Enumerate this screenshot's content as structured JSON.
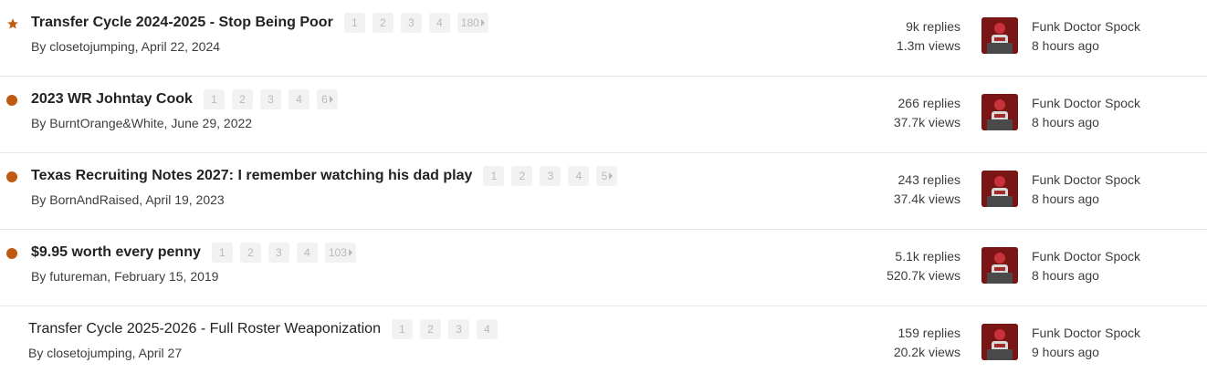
{
  "topics": [
    {
      "marker": "star",
      "title": "Transfer Cycle 2024-2025 - Stop Being Poor",
      "bold": true,
      "pages": [
        "1",
        "2",
        "3",
        "4",
        "180"
      ],
      "author": "closetojumping",
      "date": "April 22, 2024",
      "replies": "9k replies",
      "views": "1.3m views",
      "last_poster": "Funk Doctor Spock",
      "last_time": "8 hours ago"
    },
    {
      "marker": "dot",
      "title": "2023 WR Johntay Cook",
      "bold": true,
      "pages": [
        "1",
        "2",
        "3",
        "4",
        "6"
      ],
      "author": "BurntOrange&White",
      "date": "June 29, 2022",
      "replies": "266 replies",
      "views": "37.7k views",
      "last_poster": "Funk Doctor Spock",
      "last_time": "8 hours ago"
    },
    {
      "marker": "dot",
      "title": "Texas Recruiting Notes 2027: I remember watching his dad play",
      "bold": true,
      "pages": [
        "1",
        "2",
        "3",
        "4",
        "5"
      ],
      "author": "BornAndRaised",
      "date": "April 19, 2023",
      "replies": "243 replies",
      "views": "37.4k views",
      "last_poster": "Funk Doctor Spock",
      "last_time": "8 hours ago"
    },
    {
      "marker": "dot",
      "title": "$9.95 worth every penny",
      "bold": true,
      "pages": [
        "1",
        "2",
        "3",
        "4",
        "103"
      ],
      "author": "futureman",
      "date": "February 15, 2019",
      "replies": "5.1k replies",
      "views": "520.7k views",
      "last_poster": "Funk Doctor Spock",
      "last_time": "8 hours ago"
    },
    {
      "marker": "none",
      "title": "Transfer Cycle 2025-2026 - Full Roster Weaponization",
      "bold": false,
      "pages": [
        "1",
        "2",
        "3",
        "4"
      ],
      "author": "closetojumping",
      "date": "April 27",
      "replies": "159 replies",
      "views": "20.2k views",
      "last_poster": "Funk Doctor Spock",
      "last_time": "9 hours ago"
    }
  ],
  "colors": {
    "accent": "#bf5a10",
    "divider": "#e6e6e6",
    "pagebox": "#f2f2f2"
  },
  "icons": {
    "star": "star-icon",
    "dot": "unread-dot-icon",
    "more": "caret-right-icon"
  }
}
